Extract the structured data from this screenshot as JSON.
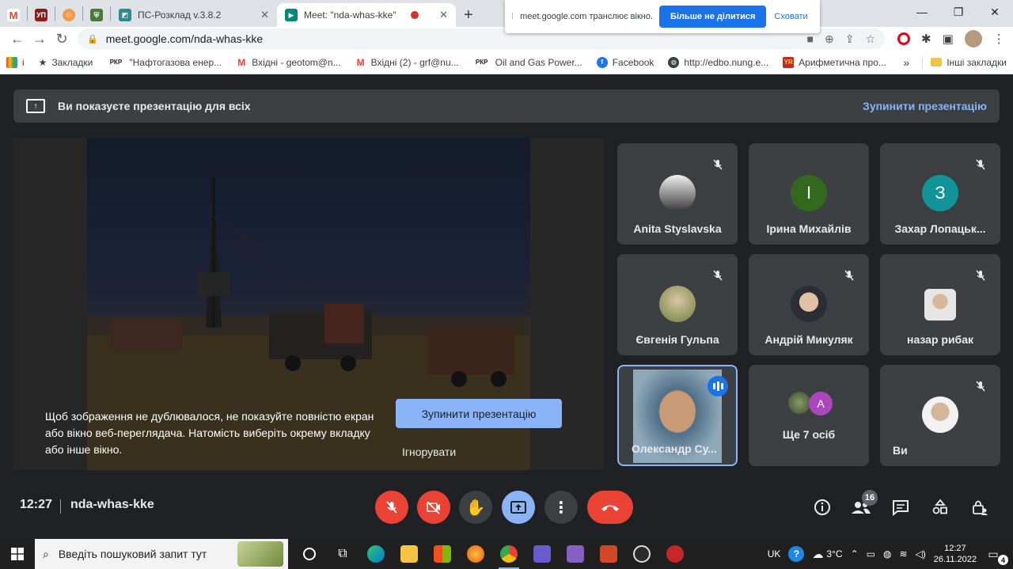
{
  "browser": {
    "tabs": [
      {
        "label": "",
        "icon": "gmail-icon"
      },
      {
        "label": "УП",
        "icon": "up-icon"
      },
      {
        "label": "",
        "icon": "smiley-icon"
      },
      {
        "label": "",
        "icon": "crest-icon"
      },
      {
        "label": "ПС-Розклад v.3.8.2",
        "icon": "schedule-icon"
      },
      {
        "label": "Meet: \"nda-whas-kke\"",
        "icon": "meet-icon"
      }
    ],
    "url": "meet.google.com/nda-whas-kke",
    "bookmarks": [
      {
        "label": "і",
        "icon": "apps-icon"
      },
      {
        "label": "Закладки",
        "icon": "star-icon"
      },
      {
        "label": "\"Нафтогазова енер...",
        "icon": "pkp-icon",
        "badge": "РКР"
      },
      {
        "label": "Вхідні - geotom@n...",
        "icon": "gmail-icon"
      },
      {
        "label": "Вхідні (2) - grf@nu...",
        "icon": "gmail-icon"
      },
      {
        "label": "Oil and Gas Power...",
        "icon": "pkp-icon",
        "badge": "РКР"
      },
      {
        "label": "Facebook",
        "icon": "facebook-icon"
      },
      {
        "label": "http://edbo.nung.e...",
        "icon": "globe-icon"
      },
      {
        "label": "Арифметична про...",
        "icon": "yr-icon",
        "badge": "YR"
      }
    ],
    "bookmarks_more": "»",
    "other_bookmarks": "Інші закладки"
  },
  "share_popup": {
    "text": "meet.google.com транслює вікно.",
    "stop_label": "Більше не ділитися",
    "hide_label": "Сховати"
  },
  "banner": {
    "text": "Ви показуєте презентацію для всіх",
    "stop_label": "Зупинити презентацію"
  },
  "stage": {
    "message": "Щоб зображення не дублювалося, не показуйте повністю екран або вікно веб-переглядача. Натомість виберіть окрему вкладку або інше вікно.",
    "stop_label": "Зупинити презентацію",
    "ignore_label": "Ігнорувати"
  },
  "participants": [
    {
      "name": "Anita Styslavska",
      "muted": true,
      "avatar_color": "#d7d7d7",
      "initial": ""
    },
    {
      "name": "Ірина Михайлів",
      "muted": false,
      "avatar_color": "#33691e",
      "initial": "І"
    },
    {
      "name": "Захар Лопацьк...",
      "muted": true,
      "avatar_color": "#12939a",
      "initial": "З"
    },
    {
      "name": "Євгенія Гульпа",
      "muted": true,
      "avatar_color": "#8a9a4f",
      "initial": ""
    },
    {
      "name": "Андрій Микуляк",
      "muted": true,
      "avatar_color": "#cfd3d6",
      "initial": ""
    },
    {
      "name": "назар рибак",
      "muted": true,
      "avatar_color": "#bdbdbd",
      "initial": ""
    },
    {
      "name": "Олександр Су...",
      "muted": false,
      "speaking": true,
      "avatar_color": "#a0805f",
      "initial": ""
    },
    {
      "name": "Ще 7 осіб",
      "muted": false,
      "avatar_color": "#ab47bc",
      "initial": "A"
    },
    {
      "name": "Ви",
      "muted": true,
      "avatar_color": "#e0e0e0",
      "initial": ""
    }
  ],
  "controls": {
    "time": "12:27",
    "meeting_code": "nda-whas-kke",
    "people_count": "16"
  },
  "taskbar": {
    "search_placeholder": "Введіть пошуковий запит тут",
    "lang": "UK",
    "weather": "3°C",
    "time": "12:27",
    "date": "26.11.2022",
    "notifications": "4"
  }
}
